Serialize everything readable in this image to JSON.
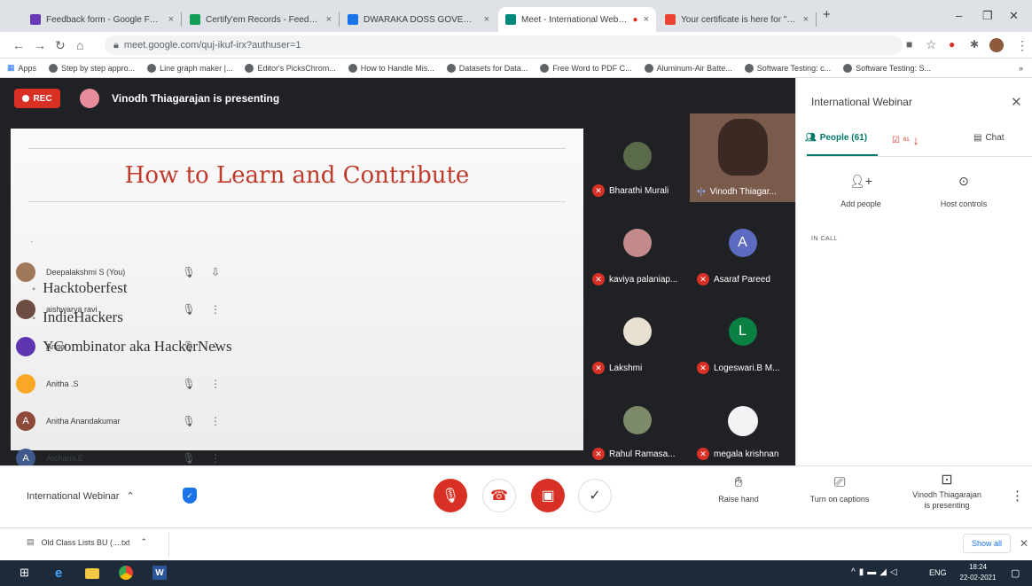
{
  "browser": {
    "tabs": [
      {
        "title": "Feedback form - Google Forms",
        "color": "#673ab7"
      },
      {
        "title": "Certify'em Records - Feedback fo",
        "color": "#0f9d58"
      },
      {
        "title": "DWARAKA DOSS GOVERDHAN D",
        "color": "#1a73e8"
      },
      {
        "title": "Meet - International Webinar",
        "color": "#00897b"
      },
      {
        "title": "Your certificate is here for \"Feedb",
        "color": "#ea4335"
      }
    ],
    "new_tab": "+",
    "url": "meet.google.com/quj-ikuf-irx?authuser=1",
    "bookmarks": [
      "Apps",
      "Step by step appro...",
      "Line graph maker |...",
      "Editor's PicksChrom...",
      "How to Handle Mis...",
      "Datasets for Data...",
      "Free Word to PDF C...",
      "Aluminum-Air Batte...",
      "Software Testing: c...",
      "Software Testing: S..."
    ]
  },
  "meet": {
    "rec_label": "REC",
    "presenting_text": "Vinodh Thiagarajan is presenting",
    "slide": {
      "title": "How to Learn and Contribute",
      "bullets": [
        "Hacktoberfest",
        "IndieHackers",
        "YCombinator aka HackerNews"
      ]
    },
    "tiles": [
      {
        "name": "Bharathi Murali"
      },
      {
        "name": "Vinodh Thiagar..."
      },
      {
        "name": "kaviya palaniap..."
      },
      {
        "name": "Asaraf Pareed",
        "initial": "A"
      },
      {
        "name": "Lakshmi"
      },
      {
        "name": "Logeswari.B M...",
        "initial": "L"
      },
      {
        "name": "Rahul Ramasa..."
      },
      {
        "name": "megala krishnan"
      }
    ]
  },
  "panel": {
    "title": "International Webinar",
    "tab_people": "People (61)",
    "badge_count": "61",
    "tab_chat": "Chat",
    "add_people": "Add people",
    "host_controls": "Host controls",
    "in_call": "IN CALL",
    "participants": [
      {
        "name": "Deepalakshmi S (You)"
      },
      {
        "name": "aishwarya ravi"
      },
      {
        "name": "Angel"
      },
      {
        "name": "Anitha .S"
      },
      {
        "name": "Anitha Anandakumar",
        "initial": "A"
      },
      {
        "name": "Archana.E",
        "initial": "A"
      }
    ]
  },
  "bottom": {
    "meeting_name": "International Webinar",
    "raise_hand": "Raise hand",
    "captions": "Turn on captions",
    "presenting_line1": "Vinodh Thiagarajan",
    "presenting_line2": "is presenting"
  },
  "downloads": {
    "file": "Old Class Lists BU (....txt",
    "show_all": "Show all"
  },
  "taskbar": {
    "lang": "ENG",
    "time": "18:24",
    "date": "22-02-2021"
  }
}
